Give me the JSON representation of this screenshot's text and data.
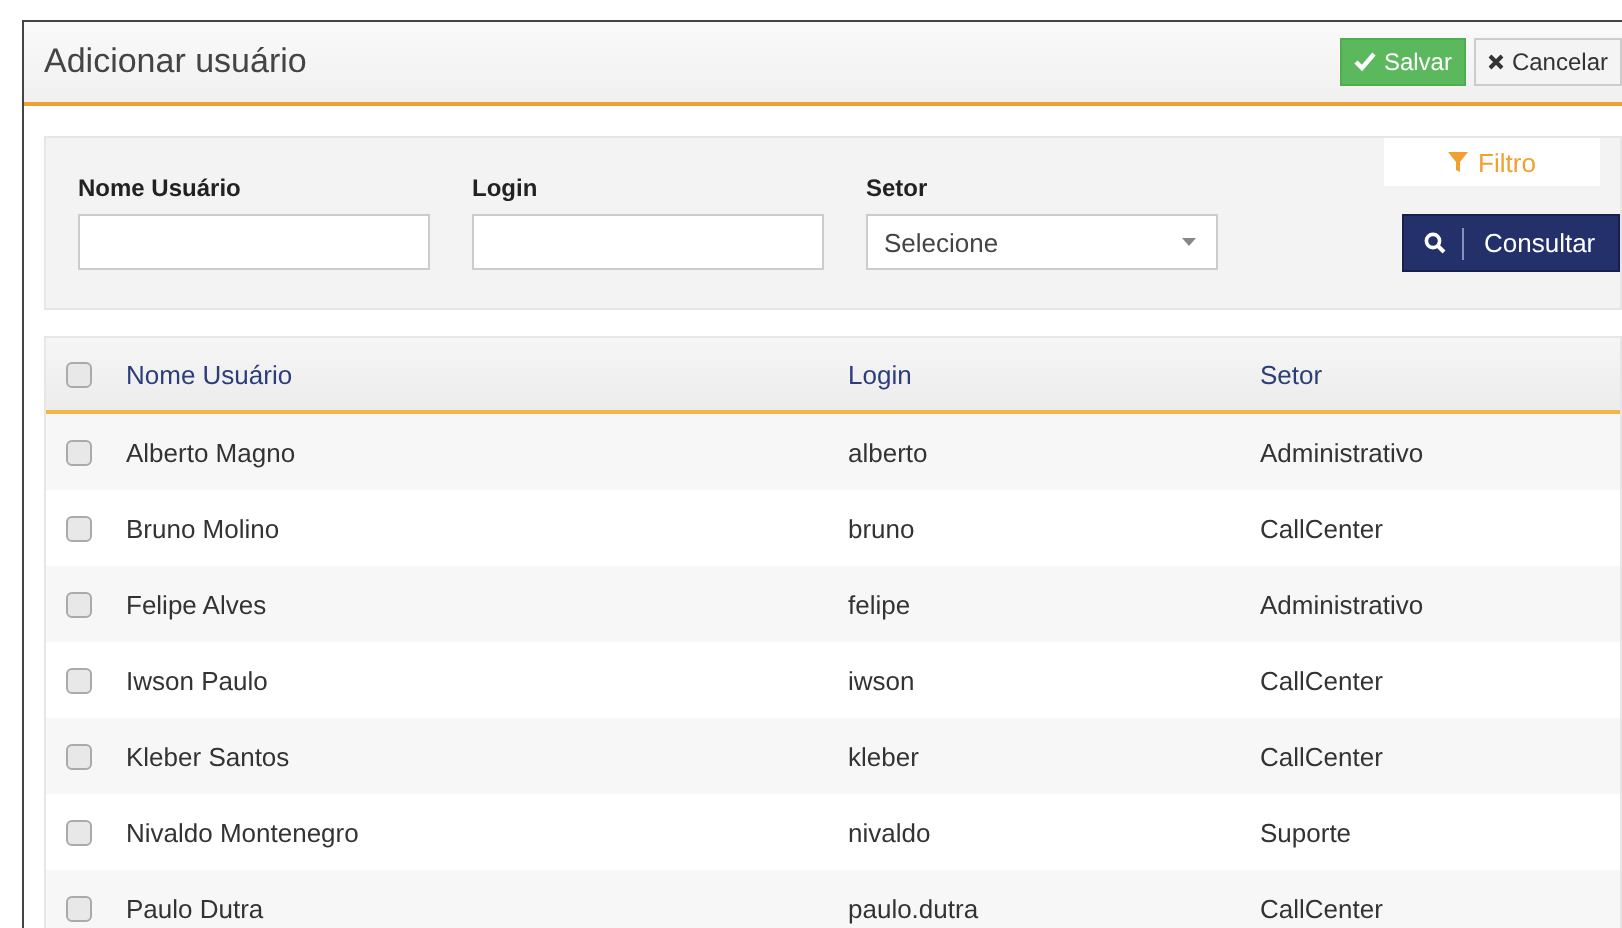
{
  "dialog": {
    "title": "Adicionar usuário",
    "buttons": [
      {
        "kind": "save",
        "label": "Salvar"
      },
      {
        "kind": "cancel",
        "label": "Cancelar"
      }
    ]
  },
  "filter": {
    "fields": [
      {
        "kind": "text",
        "label": "Nome Usuário"
      },
      {
        "kind": "text",
        "label": "Login"
      },
      {
        "kind": "select",
        "label": "Setor",
        "value": "Selecione"
      }
    ],
    "filter_tab": "Filtro",
    "search_button": "Consultar"
  },
  "table": {
    "select_all": {
      "checked": false
    },
    "columns": [
      "Nome Usuário",
      "Login",
      "Setor"
    ],
    "rows": [
      {
        "checked": false,
        "cells": [
          "Alberto Magno",
          "alberto",
          "Administrativo"
        ]
      },
      {
        "checked": false,
        "cells": [
          "Bruno Molino",
          "bruno",
          "CallCenter"
        ]
      },
      {
        "checked": false,
        "cells": [
          "Felipe Alves",
          "felipe",
          "Administrativo"
        ]
      },
      {
        "checked": false,
        "cells": [
          "Iwson Paulo",
          "iwson",
          "CallCenter"
        ]
      },
      {
        "checked": false,
        "cells": [
          "Kleber Santos",
          "kleber",
          "CallCenter"
        ]
      },
      {
        "checked": false,
        "cells": [
          "Nivaldo Montenegro",
          "nivaldo",
          "Suporte"
        ]
      },
      {
        "checked": false,
        "cells": [
          "Paulo Dutra",
          "paulo.dutra",
          "CallCenter"
        ]
      }
    ]
  }
}
